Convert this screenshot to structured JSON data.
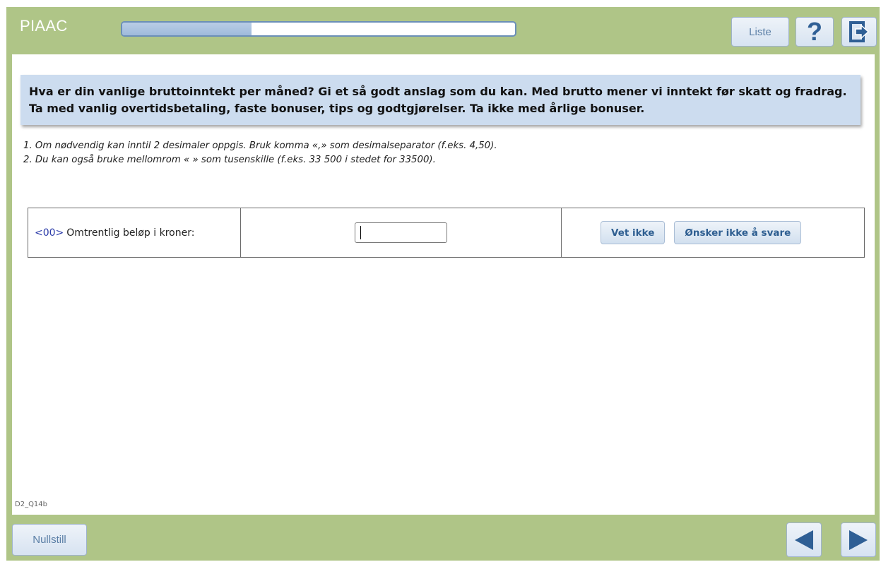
{
  "header": {
    "logo": "PIAAC",
    "progress": 0.33,
    "list_label": "Liste",
    "help_icon": "question-mark-icon",
    "exit_icon": "exit-door-icon"
  },
  "question": {
    "text": "Hva er din vanlige bruttoinntekt per måned? Gi et så godt anslag som du kan. Med brutto mener vi inntekt før skatt og fradrag. Ta med vanlig overtidsbetaling, faste bonuser, tips og godtgjørelser. Ta ikke med årlige bonuser."
  },
  "notes": [
    "1. Om nødvendig kan inntil 2 desimaler oppgis. Bruk komma «,» som desimalseparator (f.eks. 4,50).",
    "2. Du kan også bruke mellomrom « » som tusenskille (f.eks. 33 500 i stedet for 33500)."
  ],
  "answer": {
    "code": "<00>",
    "label": "Omtrentlig beløp i kroner:",
    "value": "",
    "dont_know_label": "Vet ikke",
    "refuse_label": "Ønsker ikke å svare"
  },
  "screen_id": "D2_Q14b",
  "footer": {
    "reset_label": "Nullstill",
    "prev_icon": "arrow-left-icon",
    "next_icon": "arrow-right-icon"
  },
  "colors": {
    "frame_green": "#afc587",
    "question_bg": "#ccdcef",
    "button_text": "#2e5e91",
    "progress_fill": "#9fbadb",
    "icon_blue": "#2f5f95"
  }
}
